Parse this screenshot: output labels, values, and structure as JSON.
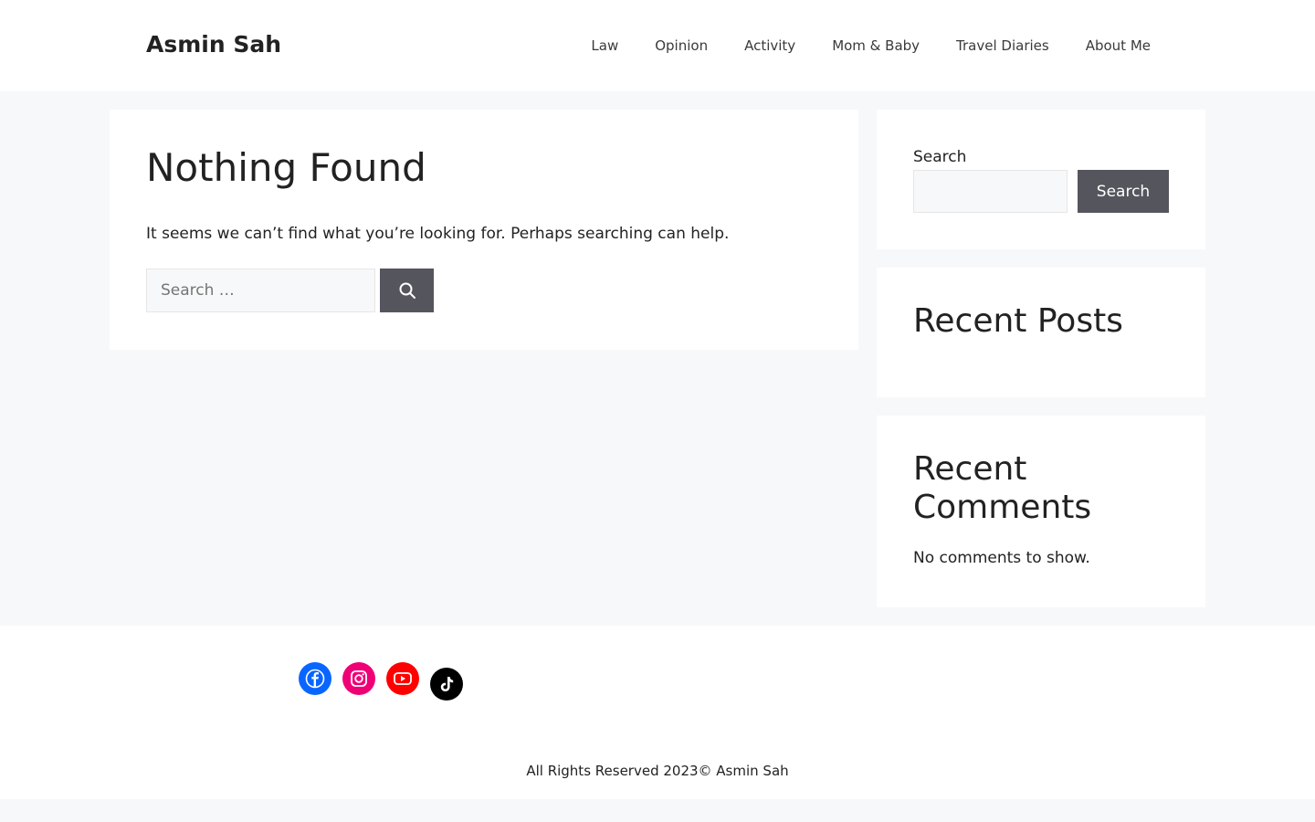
{
  "header": {
    "site_title": "Asmin Sah",
    "nav": [
      {
        "label": "Law"
      },
      {
        "label": "Opinion"
      },
      {
        "label": "Activity"
      },
      {
        "label": "Mom & Baby"
      },
      {
        "label": "Travel Diaries"
      },
      {
        "label": "About Me"
      }
    ]
  },
  "main": {
    "title": "Nothing Found",
    "message": "It seems we can’t find what you’re looking for. Perhaps searching can help.",
    "search": {
      "placeholder": "Search …",
      "icon": "search-icon"
    }
  },
  "sidebar": {
    "search_widget": {
      "label": "Search",
      "button_label": "Search"
    },
    "recent_posts": {
      "title": "Recent Posts"
    },
    "recent_comments": {
      "title": "Recent Comments",
      "empty_text": "No comments to show."
    }
  },
  "footer": {
    "social": [
      {
        "icon": "facebook-icon",
        "color": "#0866ff"
      },
      {
        "icon": "instagram-icon",
        "color": "#f00075"
      },
      {
        "icon": "youtube-icon",
        "color": "#ff0000"
      },
      {
        "icon": "tiktok-icon",
        "color": "#000000"
      }
    ],
    "copyright": "All Rights Reserved 2023© Asmin Sah"
  },
  "colors": {
    "page_background": "#f7f8f9",
    "button_background": "#55555e",
    "text": "#222222"
  }
}
